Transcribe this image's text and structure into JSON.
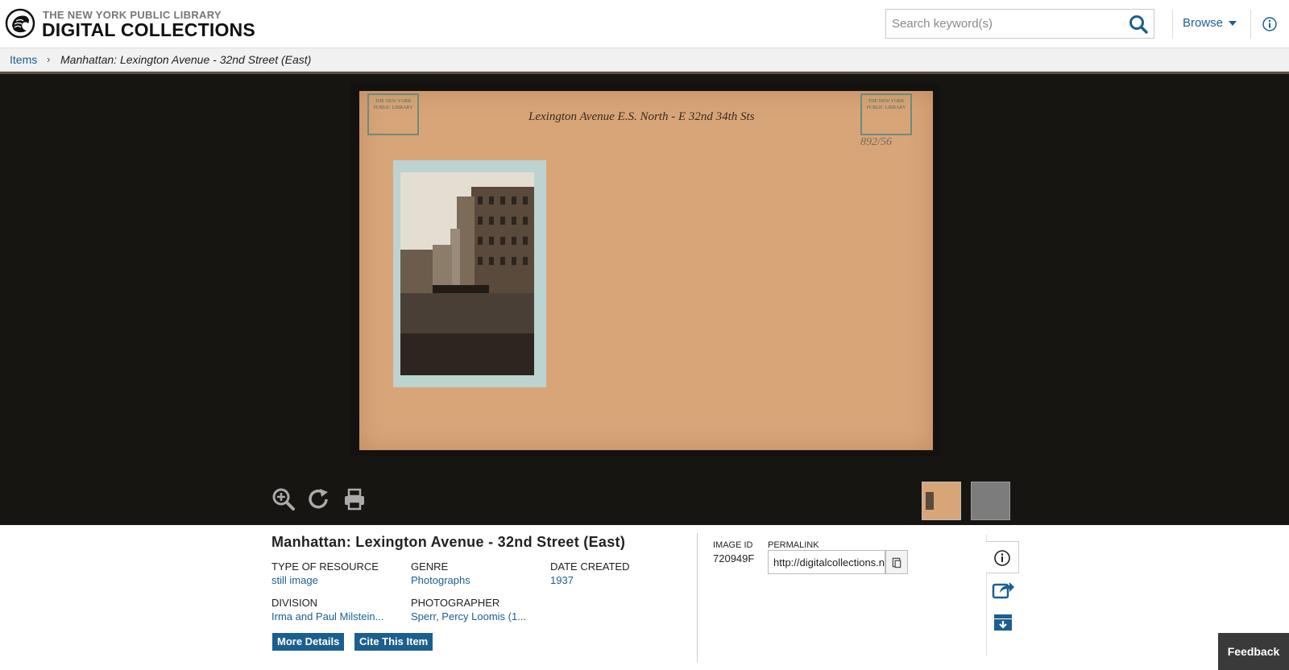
{
  "header": {
    "logo_line1": "THE NEW YORK PUBLIC LIBRARY",
    "logo_line2": "DIGITAL COLLECTIONS",
    "search_placeholder": "Search keyword(s)",
    "browse_label": "Browse",
    "accent_color": "#1c5f8f"
  },
  "breadcrumb": {
    "items_label": "Items",
    "separator": "›",
    "current": "Manhattan: Lexington Avenue - 32nd Street (East)"
  },
  "viewer": {
    "card_title": "Lexington Avenue E.S. North - E 32nd 34th Sts",
    "card_number": "892/56",
    "stamp_text": "THE NEW YORK PUBLIC LIBRARY",
    "tools": [
      "zoom-in-icon",
      "rotate-icon",
      "print-icon"
    ]
  },
  "item": {
    "title": "Manhattan: Lexington Avenue - 32nd Street (East)",
    "fields": {
      "type_label": "Type of Resource",
      "type_value": "still image",
      "genre_label": "Genre",
      "genre_value": "Photographs",
      "date_label": "Date Created",
      "date_value": "1937",
      "division_label": "Division",
      "division_value": "Irma and Paul Milstein...",
      "photographer_label": "Photographer",
      "photographer_value": "Sperr, Percy Loomis (1..."
    },
    "more_details": "More Details",
    "cite_item": "Cite This Item",
    "image_id_label": "Image ID",
    "image_id": "720949F",
    "permalink_label": "Permalink",
    "permalink_value": "http://digitalcollections.nypl.org"
  },
  "feedback_label": "Feedback"
}
